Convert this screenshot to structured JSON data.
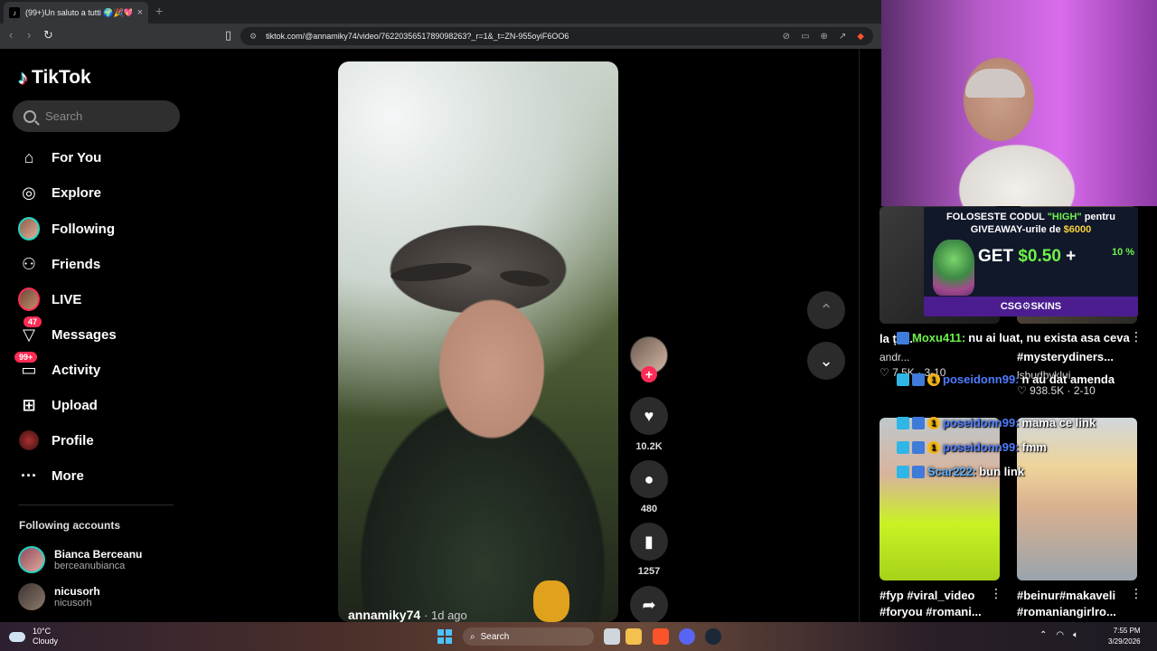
{
  "browser": {
    "tab_title": "(99+)Un saluto a tutti 🌍🎉💖🍕",
    "tab_close": "×",
    "new_tab": "+",
    "url": "tiktok.com/@annamiky74/video/7622035651789098263?_r=1&_t=ZN-955oyiF6OO6"
  },
  "tiktok": {
    "logo_text": "TikTok",
    "search_placeholder": "Search",
    "nav": [
      {
        "label": "For You",
        "icon": "home-icon"
      },
      {
        "label": "Explore",
        "icon": "compass-icon"
      },
      {
        "label": "Following",
        "icon": "avatar-icon"
      },
      {
        "label": "Friends",
        "icon": "friends-icon"
      },
      {
        "label": "LIVE",
        "icon": "live-icon"
      },
      {
        "label": "Messages",
        "icon": "inbox-icon",
        "badge": "47"
      },
      {
        "label": "Activity",
        "icon": "activity-icon",
        "badge": "99+"
      },
      {
        "label": "Upload",
        "icon": "upload-icon"
      },
      {
        "label": "Profile",
        "icon": "profile-icon"
      },
      {
        "label": "More",
        "icon": "more-icon"
      }
    ],
    "following_title": "Following accounts",
    "following_accounts": [
      {
        "name": "Bianca Berceanu",
        "handle": "berceanubianca"
      },
      {
        "name": "nicusorh",
        "handle": "nicusorh"
      }
    ],
    "video": {
      "author": "annamiky74",
      "time": "· 1d ago",
      "likes": "10.2K",
      "comments": "480",
      "saves": "1257"
    }
  },
  "right_column": {
    "row1": [
      {
        "caption": "la ț... ...",
        "author": "andr...",
        "likes": "7.5K",
        "date": "3-10"
      },
      {
        "caption": "#mysterydiners...",
        "author": "lsbudbyklui",
        "likes": "938.5K",
        "date": "2-10"
      }
    ],
    "row2": [
      {
        "caption": "#fyp #viral_video #foryou #romani..."
      },
      {
        "caption": "#beinur#makaveli #romaniangirlro..."
      }
    ]
  },
  "stream": {
    "promo": {
      "line1": "FOLOSESTE CODUL",
      "code": "\"HIGH\"",
      "line1b": "pentru",
      "line2": "GIVEAWAY-urile de",
      "amount": "$6000",
      "get": "GET",
      "get_amount": "$0.50",
      "plus": "+",
      "pct": "10 %",
      "brand": "CSG⚙SKINS"
    },
    "chat": [
      {
        "user": "Moxu411:",
        "msg": "nu ai luat, nu exista asa ceva",
        "color": "green"
      },
      {
        "user": "poseidonn99:",
        "msg": "n au dat amenda",
        "color": "blue"
      },
      {
        "user": "poseidonn99:",
        "msg": "mama ce link",
        "color": "blue"
      },
      {
        "user": "poseidonn99:",
        "msg": "fmm",
        "color": "blue"
      },
      {
        "user": "Scar222:",
        "msg": "bun link",
        "color": "lblue"
      }
    ]
  },
  "taskbar": {
    "temp": "10°C",
    "weather": "Cloudy",
    "search": "Search",
    "time": "7:55 PM",
    "date": "3/29/2026"
  },
  "colors": {
    "accent": "#fe2c55",
    "teal": "#25f4ee",
    "panel": "#2f2f2f"
  }
}
